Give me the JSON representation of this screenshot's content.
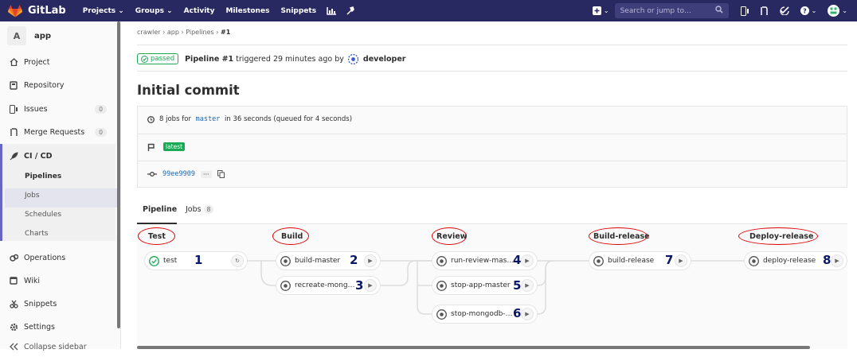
{
  "topnav": {
    "brand": "GitLab",
    "links": [
      "Projects ⌄",
      "Groups ⌄",
      "Activity",
      "Milestones",
      "Snippets"
    ],
    "search_placeholder": "Search or jump to…"
  },
  "sidebar": {
    "project_letter": "A",
    "project_name": "app",
    "items": [
      {
        "label": "Project",
        "icon": "home-icon"
      },
      {
        "label": "Repository",
        "icon": "book-icon"
      },
      {
        "label": "Issues",
        "icon": "issues-icon",
        "count": "0"
      },
      {
        "label": "Merge Requests",
        "icon": "merge-request-icon",
        "count": "0"
      },
      {
        "label": "CI / CD",
        "icon": "rocket-icon"
      },
      {
        "label": "Operations",
        "icon": "cloud-gear-icon"
      },
      {
        "label": "Wiki",
        "icon": "wiki-icon"
      },
      {
        "label": "Snippets",
        "icon": "scissors-icon"
      },
      {
        "label": "Settings",
        "icon": "settings-icon"
      },
      {
        "label": "Collapse sidebar",
        "icon": "collapse-icon"
      }
    ],
    "ci_sub": [
      "Pipelines",
      "Jobs",
      "Schedules",
      "Charts"
    ]
  },
  "breadcrumb": {
    "parts": [
      "crawler",
      "app",
      "Pipelines",
      "#1"
    ]
  },
  "status": {
    "badge": "passed",
    "title": "Pipeline #1",
    "text": " triggered 29 minutes ago by ",
    "user": "developer"
  },
  "commit_title": "Initial commit",
  "info": {
    "jobs_prefix": "8 jobs for ",
    "branch": "master",
    "jobs_suffix": " in 36 seconds (queued for 4 seconds)",
    "tag": "latest",
    "sha": "99ee9909",
    "dots": "···"
  },
  "tabs": {
    "pipeline": "Pipeline",
    "jobs": "Jobs",
    "jobs_count": "8"
  },
  "stages": [
    {
      "name": "Test",
      "jobs": [
        {
          "label": "test",
          "status": "passed-icon",
          "action": "retry-icon",
          "marker": "1"
        }
      ]
    },
    {
      "name": "Build",
      "jobs": [
        {
          "label": "build-master",
          "status": "manual-icon",
          "action": "play-icon",
          "marker": "2"
        },
        {
          "label": "recreate-mong…",
          "status": "manual-icon",
          "action": "play-icon",
          "marker": "3"
        }
      ]
    },
    {
      "name": "Review",
      "jobs": [
        {
          "label": "run-review-mas…",
          "status": "manual-icon",
          "action": "play-icon",
          "marker": "4"
        },
        {
          "label": "stop-app-master",
          "status": "manual-icon",
          "action": "play-icon",
          "marker": "5"
        },
        {
          "label": "stop-mongodb-…",
          "status": "manual-icon",
          "action": "play-icon",
          "marker": "6"
        }
      ]
    },
    {
      "name": "Build-release",
      "jobs": [
        {
          "label": "build-release",
          "status": "manual-icon",
          "action": "play-icon",
          "marker": "7"
        }
      ]
    },
    {
      "name": "Deploy-release",
      "jobs": [
        {
          "label": "deploy-release",
          "status": "manual-icon",
          "action": "play-icon",
          "marker": "8"
        }
      ]
    }
  ],
  "colors": {
    "nav": "#292961",
    "passed": "#1aaa55",
    "link": "#1b69b6",
    "annotation": "#e00000",
    "marker": "#0a1866"
  }
}
